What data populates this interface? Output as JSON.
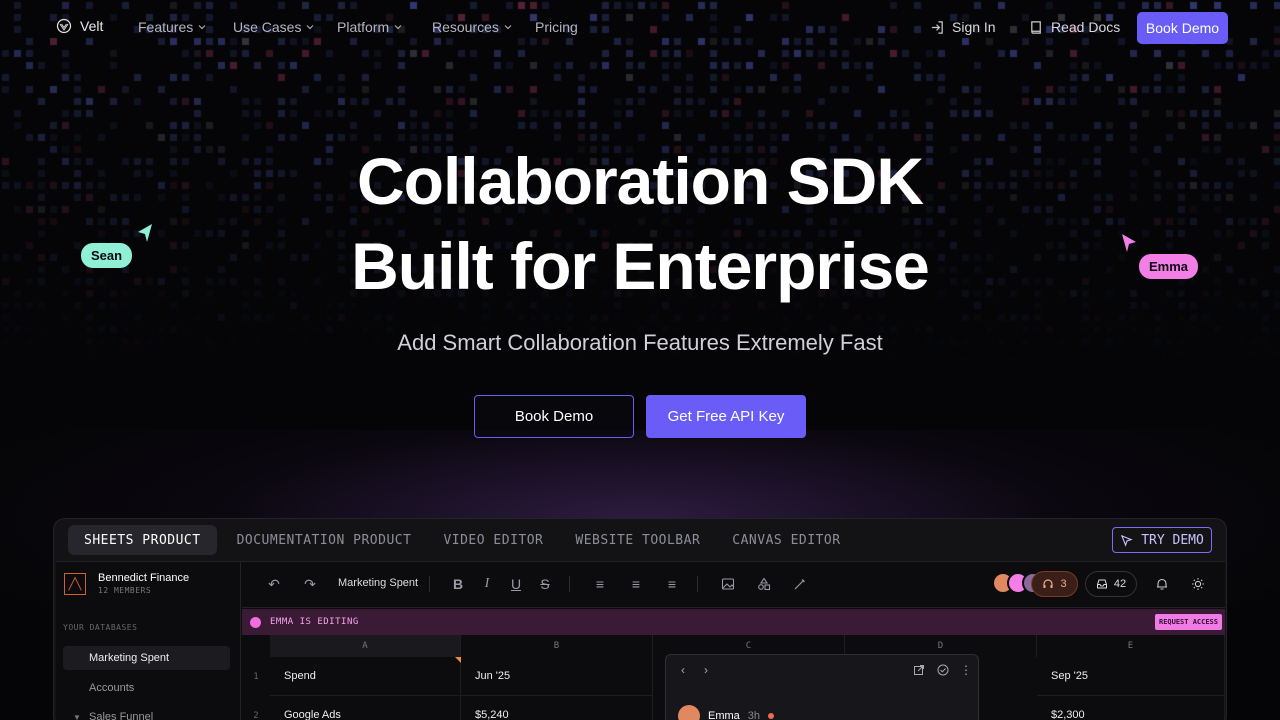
{
  "nav": {
    "logo": "Velt",
    "items": [
      "Features",
      "Use Cases",
      "Platform",
      "Resources",
      "Pricing"
    ],
    "sign_in": "Sign In",
    "read_docs": "Read Docs",
    "book_demo": "Book Demo"
  },
  "hero": {
    "title_line1": "Collaboration SDK",
    "title_line2": "Built for Enterprise",
    "subtitle": "Add Smart Collaboration Features Extremely Fast",
    "btn_book_demo": "Book Demo",
    "btn_api_key": "Get Free API Key"
  },
  "cursors": {
    "left": {
      "name": "Sean",
      "color": "#8ff0d6"
    },
    "right": {
      "name": "Emma",
      "color": "#f27ee6"
    }
  },
  "demo": {
    "tabs": [
      "SHEETS PRODUCT",
      "DOCUMENTATION PRODUCT",
      "VIDEO EDITOR",
      "WEBSITE TOOLBAR",
      "CANVAS EDITOR"
    ],
    "try_demo": "TRY DEMO",
    "workspace": {
      "name": "Bennedict Finance",
      "members": "12 MEMBERS"
    },
    "sidebar": {
      "section": "YOUR DATABASES",
      "items": [
        "Marketing Spent",
        "Accounts",
        "Sales Funnel"
      ]
    },
    "toolbar": {
      "doc_name": "Marketing Spent",
      "huddle_count": "3",
      "inbox_count": "42"
    },
    "editing_banner": "EMMA IS EDITING",
    "request_access": "REQUEST ACCESS",
    "columns": [
      "A",
      "B",
      "C",
      "D",
      "E"
    ],
    "rows": [
      {
        "num": "1",
        "a": "Spend",
        "b": "Jun '25",
        "e": "Sep '25"
      },
      {
        "num": "2",
        "a": "Google Ads",
        "b": "$5,240",
        "e": "$2,300"
      }
    ],
    "comment": {
      "user": "Emma",
      "time": "3h"
    }
  }
}
